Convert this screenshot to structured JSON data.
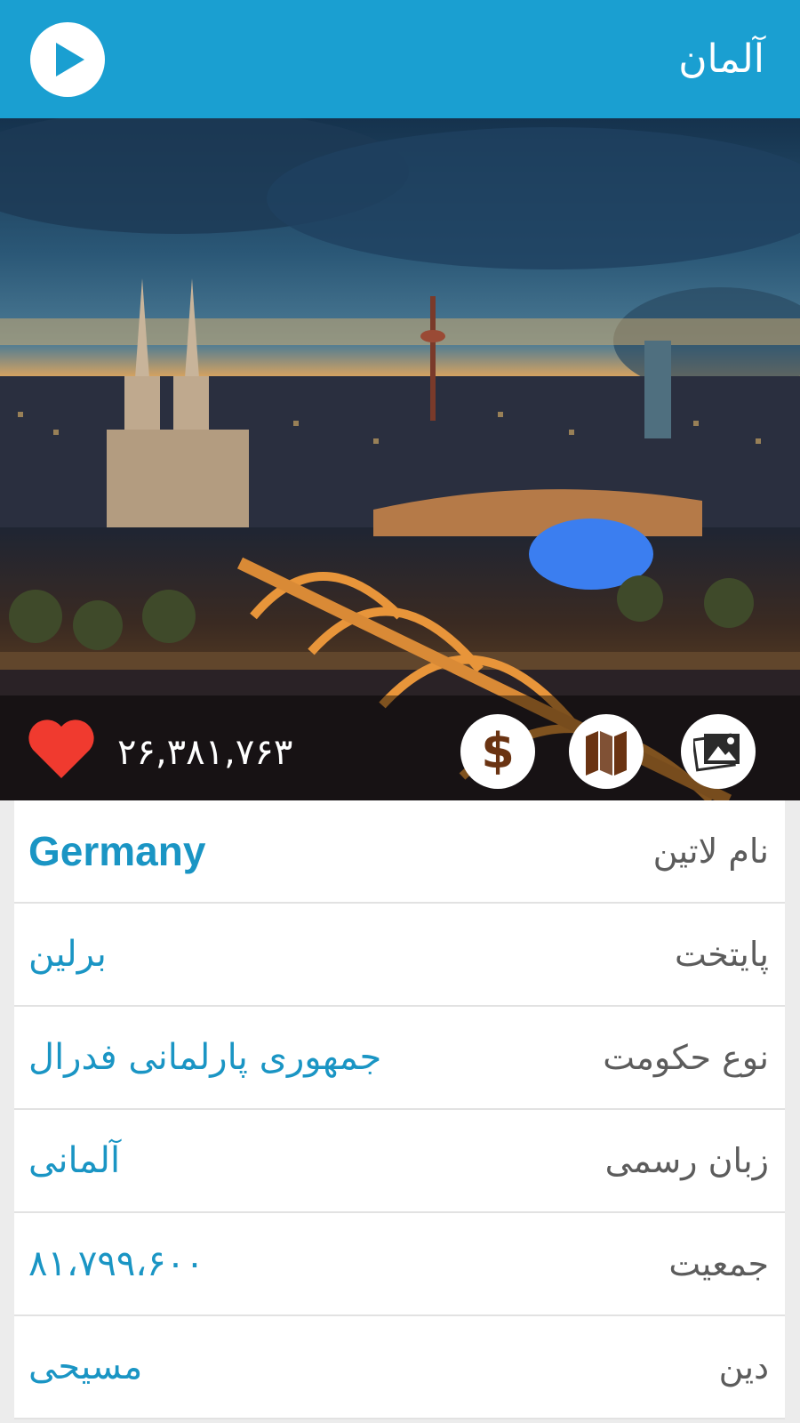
{
  "appbar": {
    "title": "آلمان",
    "play_icon": "play-icon",
    "background": "#1a9fd1"
  },
  "hero": {
    "image_alt": "Cologne skyline at dusk with cathedral and Hohenzollern bridge",
    "favorite_icon": "heart-icon",
    "favorite_count": "۲۶,۳۸۱,۷۶۳",
    "actions": [
      {
        "icon": "gallery-icon"
      },
      {
        "icon": "map-icon"
      },
      {
        "icon": "currency-icon"
      }
    ],
    "heart_color": "#f03a2f"
  },
  "info": {
    "rows": [
      {
        "label": "نام لاتین",
        "value": "Germany"
      },
      {
        "label": "پایتخت",
        "value": "برلین"
      },
      {
        "label": "نوع حکومت",
        "value": "جمهوری پارلمانی فدرال"
      },
      {
        "label": "زبان رسمی",
        "value": "آلمانی"
      },
      {
        "label": "جمعیت",
        "value": "۸۱،۷۹۹،۶۰۰"
      },
      {
        "label": "دین",
        "value": "مسیحی"
      }
    ],
    "value_color": "#1a95c4",
    "label_color": "#5c5c5c"
  }
}
